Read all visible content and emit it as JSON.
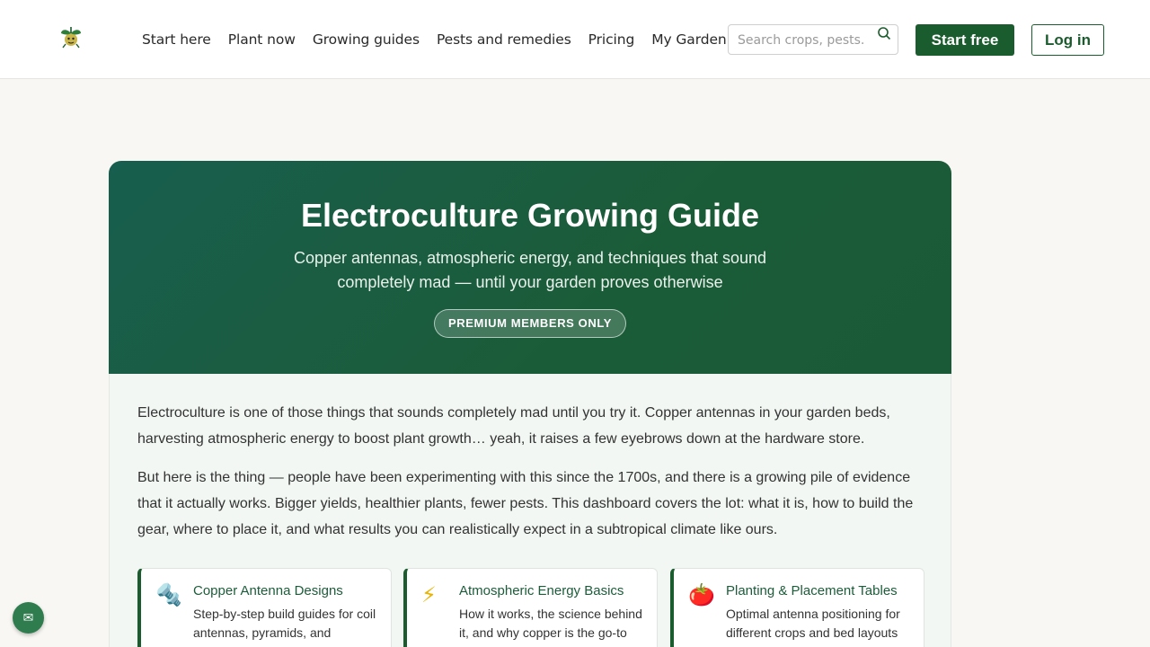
{
  "header": {
    "logo_icon": "plant-logo-icon",
    "nav": [
      {
        "label": "Start here"
      },
      {
        "label": "Plant now"
      },
      {
        "label": "Growing guides"
      },
      {
        "label": "Pests and remedies"
      },
      {
        "label": "Pricing"
      },
      {
        "label": "My Garden"
      }
    ],
    "search": {
      "placeholder": "Search crops, pests...",
      "value": "",
      "icon": "search-icon"
    },
    "start_free_label": "Start free",
    "login_label": "Log in"
  },
  "hero": {
    "title": "Electroculture Growing Guide",
    "subtitle": "Copper antennas, atmospheric energy, and techniques that sound completely mad — until your garden proves otherwise",
    "badge": "PREMIUM MEMBERS ONLY"
  },
  "content": {
    "paragraphs": [
      "Electroculture is one of those things that sounds completely mad until you try it. Copper antennas in your garden beds, harvesting atmospheric energy to boost plant growth… yeah, it raises a few eyebrows down at the hardware store.",
      "But here is the thing — people have been experimenting with this since the 1700s, and there is a growing pile of evidence that it actually works. Bigger yields, healthier plants, fewer pests. This dashboard covers the lot: what it is, how to build the gear, where to place it, and what results you can realistically expect in a subtropical climate like ours."
    ],
    "cards": [
      {
        "icon": "🔩",
        "icon_name": "bolt-nut-icon",
        "title": "Copper Antenna Designs",
        "desc": "Step-by-step build guides for coil antennas, pyramids, and"
      },
      {
        "icon": "⚡",
        "icon_name": "lightning-icon",
        "title": "Atmospheric Energy Basics",
        "desc": "How it works, the science behind it, and why copper is the go-to"
      },
      {
        "icon": "🍅",
        "icon_name": "tomato-icon",
        "title": "Planting & Placement Tables",
        "desc": "Optimal antenna positioning for different crops and bed layouts"
      }
    ]
  },
  "chat": {
    "icon": "✉",
    "icon_name": "mail-icon"
  },
  "colors": {
    "brand": "#1b5c2e",
    "hero_start": "#185e4e",
    "hero_end": "#1b5a36",
    "background": "#f8f7f3"
  }
}
